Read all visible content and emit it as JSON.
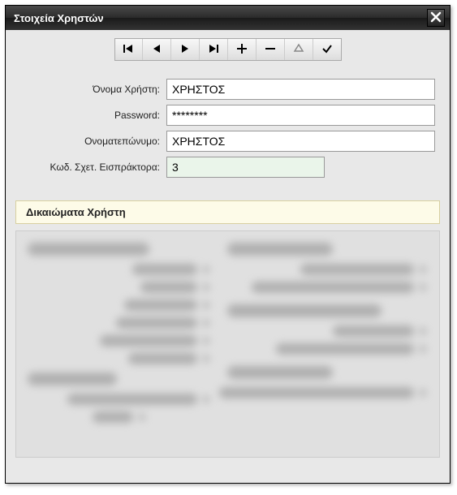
{
  "window": {
    "title": "Στοιχεία Χρηστών"
  },
  "toolbar": {
    "first": "first-record",
    "prev": "previous-record",
    "next": "next-record",
    "last": "last-record",
    "add": "add-record",
    "remove": "remove-record",
    "edit": "edit-record",
    "confirm": "confirm"
  },
  "form": {
    "username_label": "Όνομα Χρήστη:",
    "username_value": "ΧΡΗΣΤΟΣ",
    "password_label": "Password:",
    "password_value": "********",
    "fullname_label": "Ονοματεπώνυμο:",
    "fullname_value": "ΧΡΗΣΤΟΣ",
    "collectorcode_label": "Κωδ. Σχετ. Εισπράκτορα:",
    "collectorcode_value": "3"
  },
  "section": {
    "permissions_title": "Δικαιώματα Χρήστη"
  }
}
